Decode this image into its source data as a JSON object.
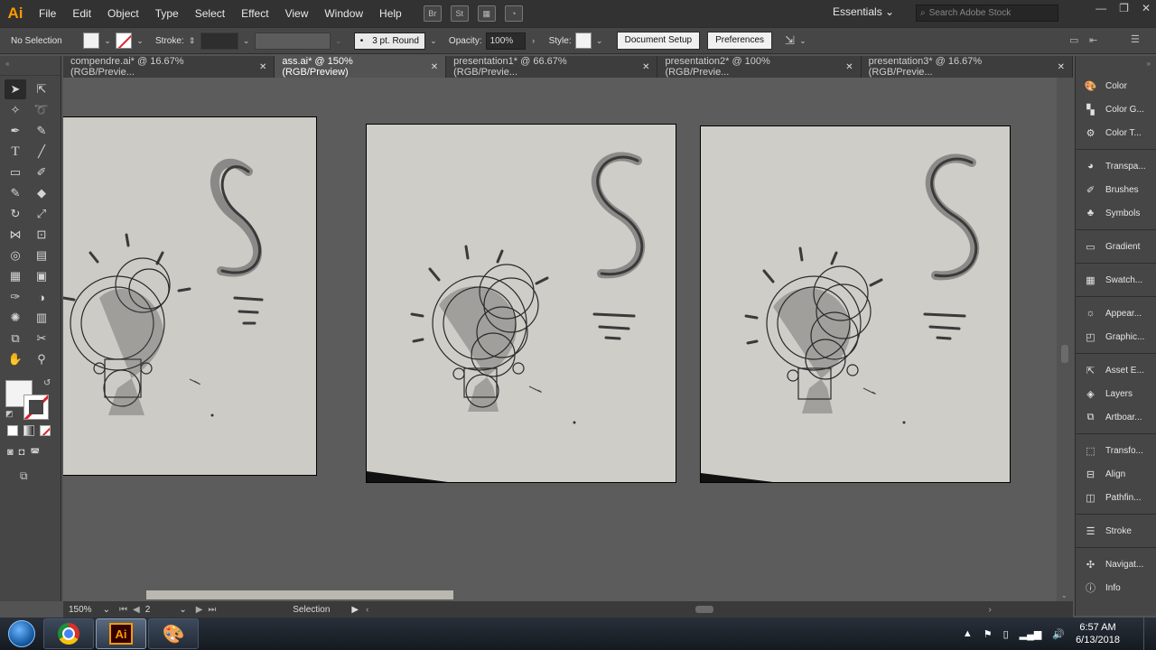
{
  "app": {
    "logo": "Ai",
    "menu": [
      "File",
      "Edit",
      "Object",
      "Type",
      "Select",
      "Effect",
      "View",
      "Window",
      "Help"
    ],
    "bridge_btn": "Br",
    "stock_btn": "St",
    "workspace": "Essentials",
    "search_placeholder": "Search Adobe Stock"
  },
  "control_bar": {
    "selection": "No Selection",
    "stroke_label": "Stroke:",
    "brush": "3 pt. Round",
    "opacity_label": "Opacity:",
    "opacity_value": "100%",
    "style_label": "Style:",
    "document_setup": "Document Setup",
    "preferences": "Preferences"
  },
  "tabs": [
    {
      "label": "compendre.ai* @ 16.67% (RGB/Previe..."
    },
    {
      "label": "ass.ai* @ 150% (RGB/Preview)"
    },
    {
      "label": "presentation1* @ 66.67% (RGB/Previe..."
    },
    {
      "label": "presentation2* @ 100% (RGB/Previe..."
    },
    {
      "label": "presentation3* @ 16.67% (RGB/Previe..."
    }
  ],
  "tabs_meta": {
    "active_index": 1
  },
  "status_bar": {
    "zoom": "150%",
    "page": "2",
    "tool": "Selection"
  },
  "panels": [
    {
      "label": "Color",
      "icon": "color-icon"
    },
    {
      "label": "Color G...",
      "icon": "color-guide-icon"
    },
    {
      "label": "Color T...",
      "icon": "color-themes-icon"
    },
    {
      "label": "Transpa...",
      "icon": "transparency-icon"
    },
    {
      "label": "Brushes",
      "icon": "brushes-icon"
    },
    {
      "label": "Symbols",
      "icon": "symbols-icon"
    },
    {
      "label": "Gradient",
      "icon": "gradient-icon"
    },
    {
      "label": "Swatch...",
      "icon": "swatches-icon"
    },
    {
      "label": "Appear...",
      "icon": "appearance-icon"
    },
    {
      "label": "Graphic...",
      "icon": "graphic-styles-icon"
    },
    {
      "label": "Asset E...",
      "icon": "asset-export-icon"
    },
    {
      "label": "Layers",
      "icon": "layers-icon"
    },
    {
      "label": "Artboar...",
      "icon": "artboards-icon"
    },
    {
      "label": "Transfo...",
      "icon": "transform-icon"
    },
    {
      "label": "Align",
      "icon": "align-icon"
    },
    {
      "label": "Pathfin...",
      "icon": "pathfinder-icon"
    },
    {
      "label": "Stroke",
      "icon": "stroke-icon"
    },
    {
      "label": "Navigat...",
      "icon": "navigator-icon"
    },
    {
      "label": "Info",
      "icon": "info-icon"
    }
  ],
  "taskbar": {
    "ai_label": "Ai",
    "time": "6:57 AM",
    "date": "6/13/2018"
  }
}
